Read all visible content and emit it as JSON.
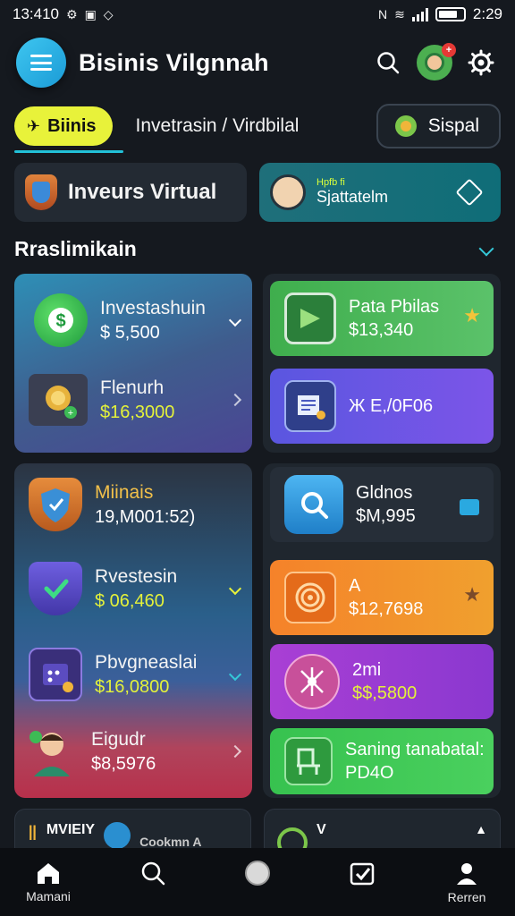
{
  "status_bar": {
    "time_left": "13:410",
    "time_right": "2:29"
  },
  "header": {
    "title": "Bisinis Vilgnnah"
  },
  "tabs": {
    "active": "Biinis",
    "middle": "Invetrasin / Virdbilal",
    "right": "Sispal"
  },
  "quick": {
    "left_label": "Inveurs Virtual",
    "right_small": "Hpfb fi",
    "right_label": "Sjattatelm"
  },
  "section": {
    "title": "Rraslimikain"
  },
  "left_panel_1": [
    {
      "label": "Investashuin",
      "value": "$ 5,500"
    },
    {
      "label": "Flenurh",
      "value": "$16,3000"
    }
  ],
  "right_panel_1": [
    {
      "label": "Pata Pbilas",
      "value": "$13,340"
    },
    {
      "label": "",
      "value": "Ж E,/0F06"
    }
  ],
  "left_panel_2": [
    {
      "label": "Miinais",
      "value": "19,M001:52)"
    },
    {
      "label": "Rvestesin",
      "value": "$ 06,460"
    },
    {
      "label": "Pbvgneaslai",
      "value": "$16,0800"
    },
    {
      "label": "Eigudr",
      "value": "$8,5976"
    }
  ],
  "right_panel_2": [
    {
      "label": "Gldnos",
      "value": "$M,995"
    },
    {
      "label": "A",
      "value": "$12,7698"
    },
    {
      "label": "2mi",
      "value": "$$,5800"
    },
    {
      "label": "Saning tanabatal:",
      "value": "PD4O"
    }
  ],
  "bottom_cards": {
    "left_label": "MVIEIY",
    "left_suffix": "Cookmn A",
    "right_label": "V"
  },
  "bottom_nav": {
    "home": "Mamani",
    "profile": "Rerren"
  },
  "colors": {
    "background": "#15191f",
    "accent_cyan": "#22c1d8",
    "accent_yellow": "#e8f23a",
    "tile_green": "#4bbd59",
    "tile_purple": "#6d55e0",
    "tile_orange": "#f5822a",
    "tile_violet": "#a93fd4",
    "tile_green2": "#37c24f"
  },
  "icons": [
    "menu-icon",
    "search-icon",
    "avatar-icon",
    "settings-icon",
    "home-icon",
    "camera-icon",
    "check-square-icon",
    "user-icon"
  ]
}
